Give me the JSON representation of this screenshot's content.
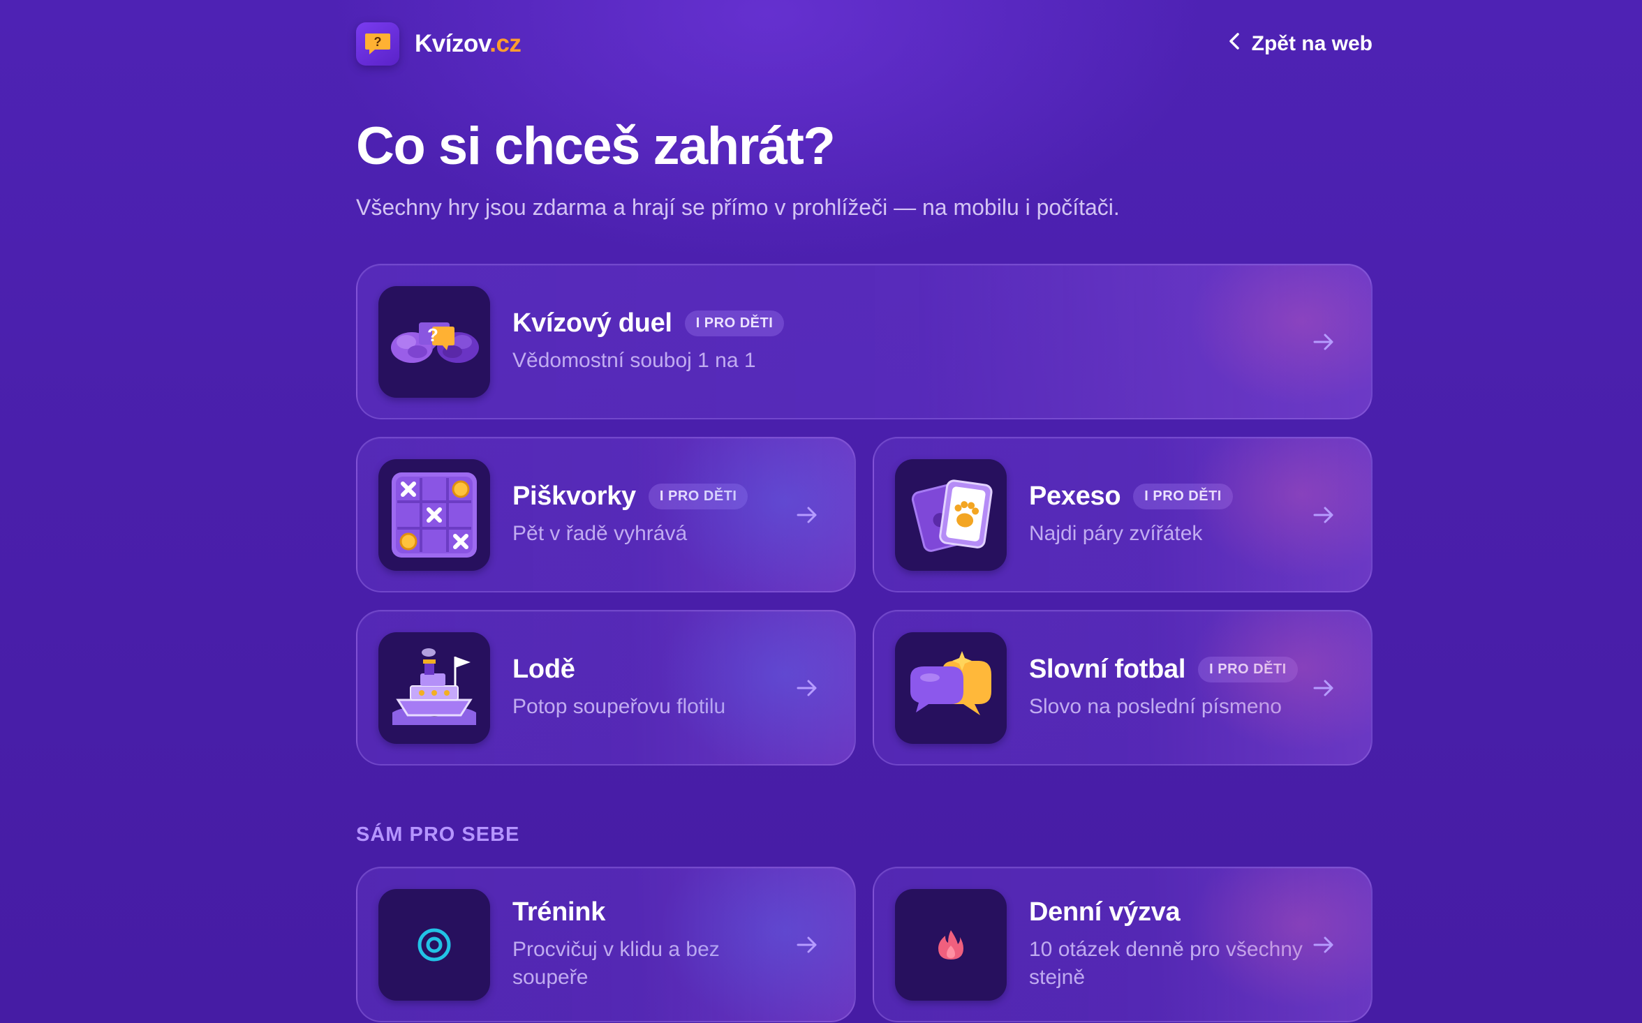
{
  "brand": {
    "name": "Kvízov",
    "tld": ".cz",
    "logo_icon": "question-bubble-icon"
  },
  "header": {
    "back_label": "Zpět na web",
    "back_icon": "chevron-left-icon"
  },
  "hero": {
    "title": "Co si chceš zahrát?",
    "subtitle": "Všechny hry jsou zdarma a hrají se přímo v prohlížeči — na mobilu i počítači."
  },
  "games": [
    {
      "title": "Kvízový duel",
      "badge": "I PRO DĚTI",
      "subtitle": "Vědomostní souboj 1 na 1",
      "icon": "brains-question-icon"
    },
    {
      "title": "Piškvorky",
      "badge": "I PRO DĚTI",
      "subtitle": "Pět v řadě vyhrává",
      "icon": "tic-tac-toe-icon"
    },
    {
      "title": "Pexeso",
      "badge": "I PRO DĚTI",
      "subtitle": "Najdi páry zvířátek",
      "icon": "paw-cards-icon"
    },
    {
      "title": "Lodě",
      "badge": "",
      "subtitle": "Potop soupeřovu flotilu",
      "icon": "ship-icon"
    },
    {
      "title": "Slovní fotbal",
      "badge": "I PRO DĚTI",
      "subtitle": "Slovo na poslední písmeno",
      "icon": "speech-bubbles-icon"
    }
  ],
  "solo": {
    "section_label": "SÁM PRO SEBE",
    "items": [
      {
        "title": "Trénink",
        "subtitle": "Procvičuj v klidu a bez soupeře",
        "icon": "target-icon"
      },
      {
        "title": "Denní výzva",
        "subtitle": "10 otázek denně pro všechny stejně",
        "icon": "flame-icon"
      }
    ]
  },
  "colors": {
    "accent_orange": "#ff9d2e",
    "section_label": "#b595ff",
    "target_cyan": "#22c3e6",
    "flame_pink": "#f0607e"
  }
}
